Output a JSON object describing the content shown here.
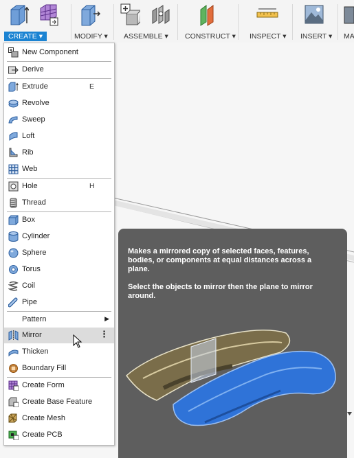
{
  "ribbon": {
    "groups": [
      {
        "label": "CREATE ▾"
      },
      {
        "label": "MODIFY ▾"
      },
      {
        "label": "ASSEMBLE ▾"
      },
      {
        "label": "CONSTRUCT ▾"
      },
      {
        "label": "INSPECT ▾"
      },
      {
        "label": "INSERT ▾"
      },
      {
        "label": "MA"
      }
    ]
  },
  "menu": {
    "items": [
      {
        "label": "New Component",
        "icon": "new-component-icon"
      },
      {
        "label": "Derive",
        "icon": "derive-icon"
      },
      {
        "label": "Extrude",
        "shortcut": "E",
        "icon": "extrude-icon"
      },
      {
        "label": "Revolve",
        "icon": "revolve-icon"
      },
      {
        "label": "Sweep",
        "icon": "sweep-icon"
      },
      {
        "label": "Loft",
        "icon": "loft-icon"
      },
      {
        "label": "Rib",
        "icon": "rib-icon"
      },
      {
        "label": "Web",
        "icon": "web-icon"
      },
      {
        "label": "Hole",
        "shortcut": "H",
        "icon": "hole-icon"
      },
      {
        "label": "Thread",
        "icon": "thread-icon"
      },
      {
        "label": "Box",
        "icon": "box-icon"
      },
      {
        "label": "Cylinder",
        "icon": "cylinder-icon"
      },
      {
        "label": "Sphere",
        "icon": "sphere-icon"
      },
      {
        "label": "Torus",
        "icon": "torus-icon"
      },
      {
        "label": "Coil",
        "icon": "coil-icon"
      },
      {
        "label": "Pipe",
        "icon": "pipe-icon"
      },
      {
        "label": "Pattern",
        "submenu": true
      },
      {
        "label": "Mirror",
        "highlighted": true,
        "icon": "mirror-icon"
      },
      {
        "label": "Thicken",
        "icon": "thicken-icon"
      },
      {
        "label": "Boundary Fill",
        "icon": "boundary-fill-icon"
      },
      {
        "label": "Create Form",
        "icon": "create-form-icon"
      },
      {
        "label": "Create Base Feature",
        "icon": "base-feature-icon"
      },
      {
        "label": "Create Mesh",
        "icon": "create-mesh-icon"
      },
      {
        "label": "Create PCB",
        "icon": "create-pcb-icon"
      }
    ]
  },
  "tooltip": {
    "description": "Makes a mirrored copy of selected faces, features, bodies, or components at equal distances across a plane.",
    "instruction": "Select the objects to mirror then the plane to mirror around."
  },
  "colors": {
    "accent": "#1b83d2",
    "tooltip_bg": "#5e5e5e",
    "menu_highlight": "#dcdcdc",
    "model_blue": "#2f73d8"
  }
}
